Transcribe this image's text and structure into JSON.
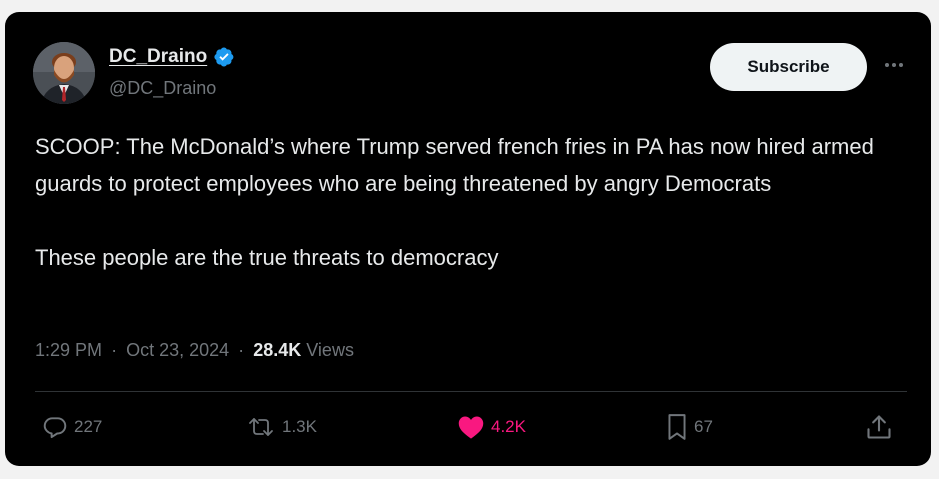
{
  "post": {
    "author": {
      "display_name": "DC_Draino",
      "handle": "@DC_Draino",
      "verified_icon": "verified-badge-icon",
      "avatar": "avatar"
    },
    "subscribe_label": "Subscribe",
    "more_icon": "more-icon",
    "text_paragraphs": [
      "SCOOP: The McDonald’s where Trump served french fries in PA has now hired armed guards to protect employees who are being threatened by angry Democrats",
      "These people are the true threats to democracy"
    ],
    "meta": {
      "time": "1:29 PM",
      "separator": "·",
      "date": "Oct 23, 2024",
      "views_count": "28.4K",
      "views_label": "Views"
    },
    "actions": {
      "replies": {
        "icon": "reply-icon",
        "count": "227"
      },
      "reposts": {
        "icon": "repost-icon",
        "count": "1.3K"
      },
      "likes": {
        "icon": "heart-icon",
        "count": "4.2K",
        "liked": true
      },
      "bookmarks": {
        "icon": "bookmark-icon",
        "count": "67"
      },
      "share": {
        "icon": "share-icon"
      }
    }
  },
  "colors": {
    "background": "#000000",
    "text": "#e7e9ea",
    "secondary_text": "#71767b",
    "verified": "#1d9bf0",
    "like": "#f91880",
    "button_bg": "#eff3f4"
  }
}
